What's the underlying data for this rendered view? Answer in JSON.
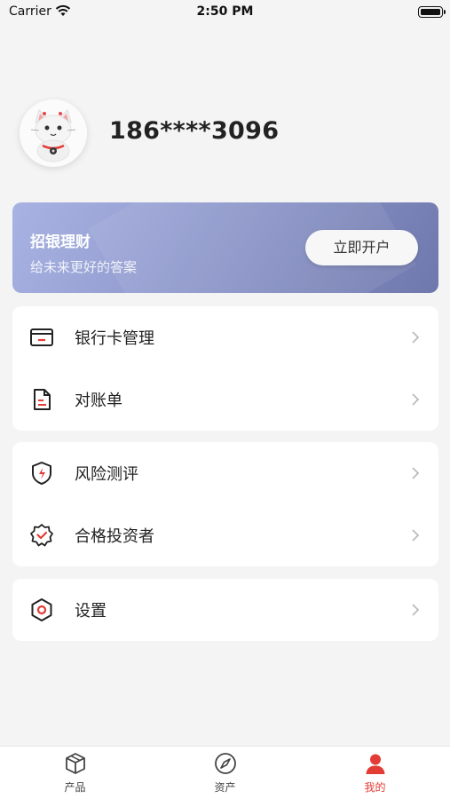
{
  "status_bar": {
    "carrier": "Carrier",
    "time": "2:50 PM"
  },
  "profile": {
    "phone": "186****3096"
  },
  "banner": {
    "title": "招银理财",
    "subtitle": "给未来更好的答案",
    "button_label": "立即开户"
  },
  "menu_groups": [
    {
      "items": [
        {
          "label": "银行卡管理",
          "icon": "bank-card-icon"
        },
        {
          "label": "对账单",
          "icon": "statement-icon"
        }
      ]
    },
    {
      "items": [
        {
          "label": "风险测评",
          "icon": "risk-shield-icon"
        },
        {
          "label": "合格投资者",
          "icon": "qualified-badge-icon"
        }
      ]
    },
    {
      "items": [
        {
          "label": "设置",
          "icon": "settings-icon"
        }
      ]
    }
  ],
  "tabbar": {
    "tabs": [
      {
        "label": "产品",
        "icon": "box-icon",
        "active": false
      },
      {
        "label": "资产",
        "icon": "compass-icon",
        "active": false
      },
      {
        "label": "我的",
        "icon": "user-icon",
        "active": true
      }
    ]
  },
  "colors": {
    "accent": "#e33b36",
    "banner_start": "#a9b3e3",
    "banner_end": "#6f78ac",
    "background": "#f4f4f5"
  }
}
